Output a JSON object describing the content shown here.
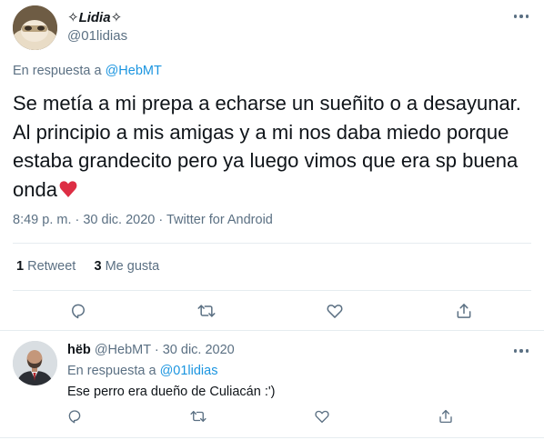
{
  "main_tweet": {
    "display_name": "✧Lidia✧",
    "handle": "@01lidias",
    "reply_prefix": "En respuesta a",
    "reply_handle": "@HebMT",
    "text": "Se metía a mi prepa a echarse un sueñito o a desayunar. Al principio a mis amigas y a mi nos daba miedo porque estaba grandecito pero ya luego vimos que era sp buena onda",
    "meta": "8:49 p. m. · 30 dic. 2020 · Twitter for Android",
    "retweets_count": "1",
    "retweets_label": "Retweet",
    "likes_count": "3",
    "likes_label": "Me gusta"
  },
  "reply_tweet": {
    "display_name": "hëb",
    "handle": "@HebMT",
    "separator": "·",
    "date": "30 dic. 2020",
    "reply_prefix": "En respuesta a",
    "reply_handle": "@01lidias",
    "text": "Ese perro era dueño de Culiacán :')"
  },
  "icons": {
    "more": "more-icon",
    "reply": "reply-icon",
    "retweet": "retweet-icon",
    "like": "like-icon",
    "share": "share-icon",
    "emoji": "red-heart-emoji"
  },
  "colors": {
    "link": "#1b95e0",
    "muted": "#5b7083",
    "text": "#0f1419",
    "divider": "#e6ecf0",
    "heart": "#dd2e44"
  }
}
